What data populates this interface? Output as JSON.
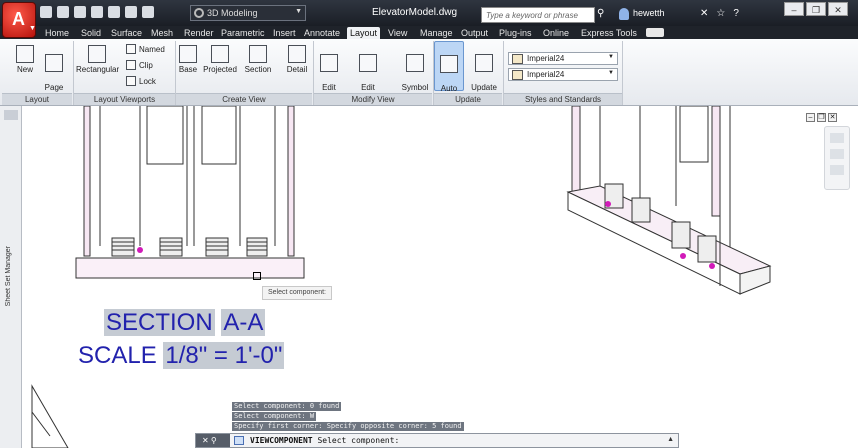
{
  "window": {
    "title": "ElevatorModel.dwg",
    "workspace": "3D Modeling",
    "search_placeholder": "Type a keyword or phrase",
    "user": "hewetth"
  },
  "tabs": [
    "Home",
    "Solid",
    "Surface",
    "Mesh",
    "Render",
    "Parametric",
    "Insert",
    "Annotate",
    "Layout",
    "View",
    "Manage",
    "Output",
    "Plug-ins",
    "Online",
    "Express Tools"
  ],
  "active_tab": "Layout",
  "ribbon": {
    "layout": {
      "label": "Layout",
      "new": "New",
      "page_setup": "Page\nSetup"
    },
    "layout_viewports": {
      "label": "Layout Viewports",
      "rectangular": "Rectangular",
      "named": "Named",
      "clip": "Clip",
      "lock": "Lock"
    },
    "create_view": {
      "label": "Create View",
      "base": "Base",
      "projected": "Projected",
      "section": "Section",
      "detail": "Detail"
    },
    "modify_view": {
      "label": "Modify View",
      "edit_view": "Edit\nView",
      "edit_components": "Edit\nComponents",
      "symbol_sketch": "Symbol\nSketch"
    },
    "update": {
      "label": "Update",
      "auto_update": "Auto\nUpdate",
      "update_view": "Update\nView"
    },
    "styles": {
      "label": "Styles and Standards",
      "style1": "Imperial24",
      "style2": "Imperial24"
    }
  },
  "drawing": {
    "sheet_set_manager": "Sheet Set Manager",
    "tooltip": "Select component:",
    "section_word": "SECTION",
    "section_id": "A-A",
    "scale_word": "SCALE",
    "scale_value": "1/8\" = 1'-0\""
  },
  "command": {
    "history": [
      "Select component: 0 found",
      "Select component: W",
      "Specify first corner: Specify opposite corner: 5 found"
    ],
    "current_cmd": "VIEWCOMPONENT",
    "current_prompt": "Select component:"
  }
}
